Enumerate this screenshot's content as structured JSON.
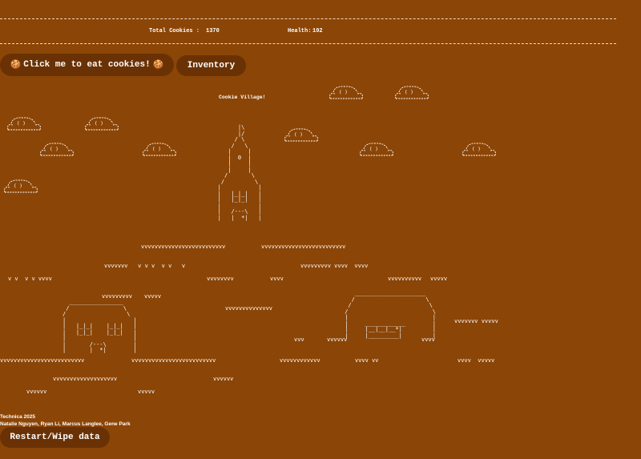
{
  "stats": {
    "cookies_label": "Total Cookies :",
    "cookies_value": "1370",
    "health_label": "Health:",
    "health_value": "102"
  },
  "buttons": {
    "eat_label": "Click me to eat cookies!",
    "inventory_label": "Inventory",
    "restart_label": "Restart/Wipe data"
  },
  "icons": {
    "cookie": "🍪"
  },
  "village": {
    "title": "Cookie Village!",
    "church_art": " |\\\n |/\n/ \\\n/   \\\n|     |\n|  0  |\n|     |\n|     |\n/       \\\n/         \\\n|           |\n|   |_|_|   |\n|   |_|_|   |\n|           |\n|   /---\\   |\n|   |  *|   |",
    "house_left_art": "  ________________\n /                \\\n/                  \\\n|                    |\n|   |_|_|    |_|_|   |\n|   |_|_|    |_|_|   |\n|                    |\n|       /---\\        |\n|       |  *|        |",
    "house_right_art": "    _____________________\n   /                     \\\n  /                       \\\n /                         \\\n |                         |\n |     ____________        |\n |     |__|__|__*|         |\n |     |_________|         |",
    "grass": [
      "vvvvvvvvvvvvvvvvvvvvvvvvv",
      "vvvvvvvvvvvvvvvvvvvvvvvvv",
      "vvvvvvv   v v v  v v   v",
      "vvvvvvvvv vvvv  vvvv",
      "v v  v v vvvv",
      "vvvvvvvv",
      "vvvv",
      "vvvvvvvvvv",
      "vvvvv",
      "vvvvvvvvv",
      "vvvvv",
      "vvvvvvvvvvvvvv",
      "vvvvvvv vvvvv",
      "vvv",
      "vvvvvv",
      "vvvv",
      "vvvvvvvvvvvvvvvvvvvvvvvvv",
      "vvvvvvvvvvvvvvvvvvvvvvvvv",
      "vvvvvvvvvvvv",
      "vvvv vv",
      "vvvv  vvvvv",
      "vvvvvvvvvvvvvvvvvvv",
      "vvvvvv",
      "vvvvvv",
      "vvvvv"
    ]
  },
  "credits": {
    "line1": "Technica 2025",
    "line2": "Natalie Nguyen, Ryan Li, Marcus Langlee, Gene Park"
  }
}
